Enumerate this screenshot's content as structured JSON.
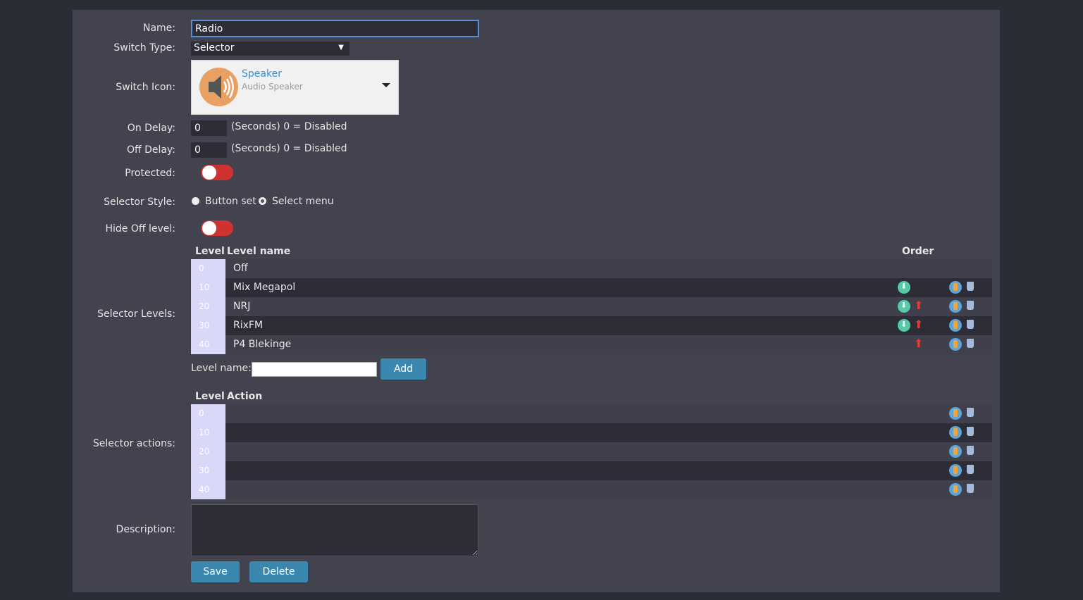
{
  "labels": {
    "name": "Name:",
    "switch_type": "Switch Type:",
    "switch_icon": "Switch Icon:",
    "on_delay": "On Delay:",
    "off_delay": "Off Delay:",
    "protected": "Protected:",
    "selector_style": "Selector Style:",
    "hide_off_level": "Hide Off level:",
    "selector_levels": "Selector Levels:",
    "selector_actions": "Selector actions:",
    "description": "Description:"
  },
  "name_value": "Radio",
  "switch_type_value": "Selector",
  "switch_icon": {
    "title": "Speaker",
    "subtitle": "Audio Speaker"
  },
  "on_delay": {
    "value": "0",
    "hint": "(Seconds) 0 = Disabled"
  },
  "off_delay": {
    "value": "0",
    "hint": "(Seconds) 0 = Disabled"
  },
  "protected": false,
  "hide_off_level": false,
  "selector_style": {
    "options": [
      "Button set",
      "Select menu"
    ],
    "selected": "Select menu"
  },
  "levels_table": {
    "headers": {
      "level": "Level",
      "name": "Level name",
      "order": "Order"
    },
    "rows": [
      {
        "level": "0",
        "name": "Off"
      },
      {
        "level": "10",
        "name": "Mix Megapol"
      },
      {
        "level": "20",
        "name": "NRJ"
      },
      {
        "level": "30",
        "name": "RixFM"
      },
      {
        "level": "40",
        "name": "P4 Blekinge"
      }
    ]
  },
  "add_level": {
    "label": "Level name:",
    "value": "",
    "button": "Add"
  },
  "actions_table": {
    "headers": {
      "level": "Level",
      "action": "Action"
    },
    "rows": [
      {
        "level": "0",
        "action": ""
      },
      {
        "level": "10",
        "action": ""
      },
      {
        "level": "20",
        "action": ""
      },
      {
        "level": "30",
        "action": ""
      },
      {
        "level": "40",
        "action": ""
      }
    ]
  },
  "description_value": "",
  "buttons": {
    "save": "Save",
    "delete": "Delete"
  },
  "colors": {
    "panel": "#43434f",
    "accent": "#3a88b0",
    "toggle_off": "#d0322f"
  }
}
